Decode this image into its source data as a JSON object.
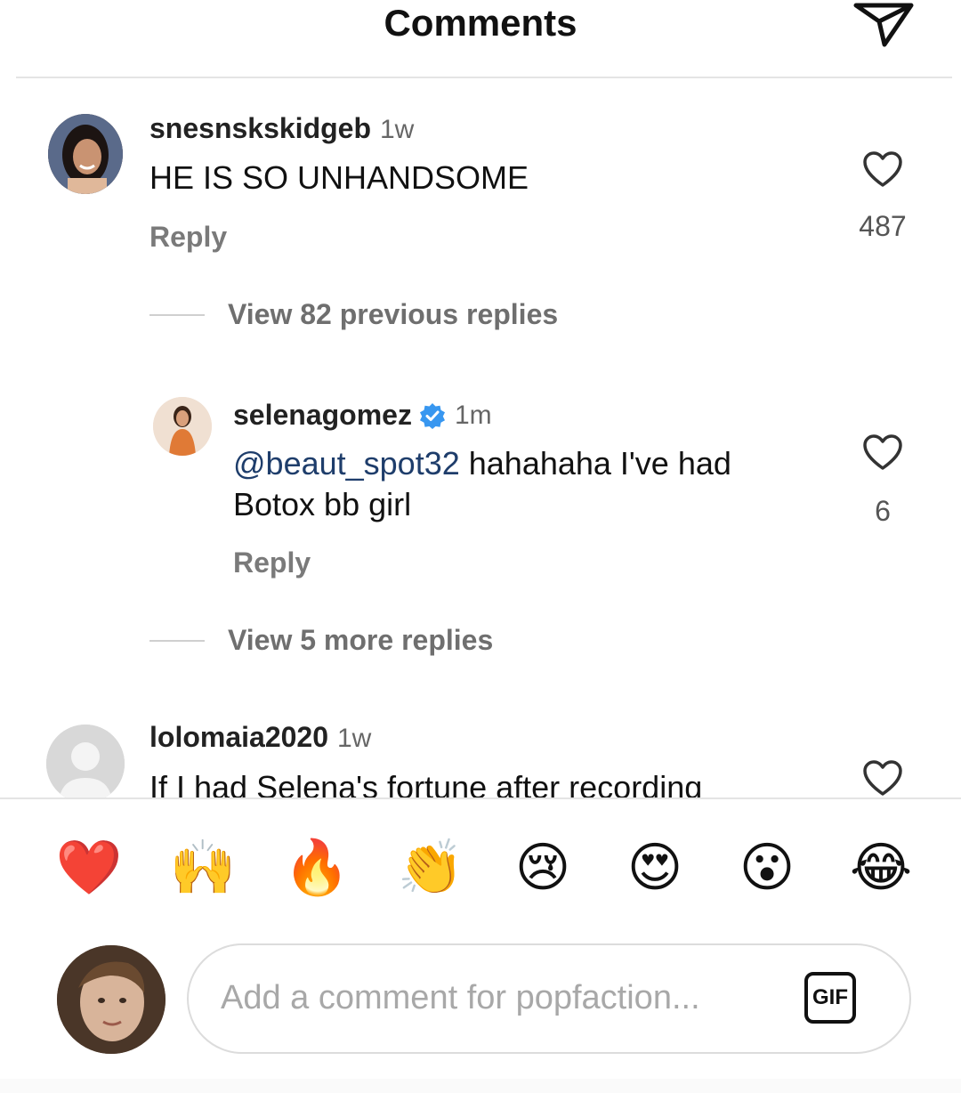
{
  "header": {
    "title": "Comments",
    "send_icon": "paper-plane-icon"
  },
  "comments": [
    {
      "username": "snesnskskidgeb",
      "time": "1w",
      "text": "HE IS SO UNHANDSOME",
      "reply_label": "Reply",
      "likes": "487",
      "view_replies": "View 82 previous replies"
    },
    {
      "username": "lolomaia2020",
      "time": "1w",
      "text": "If I had Selena's fortune after recording"
    }
  ],
  "reply": {
    "username": "selenagomez",
    "verified": true,
    "time": "1m",
    "mention": "@beaut_spot32",
    "text_line1": " hahahaha I've had",
    "text_line2": "Botox bb girl",
    "reply_label": "Reply",
    "likes": "6",
    "view_more": "View 5 more replies"
  },
  "emoji_bar": [
    "❤️",
    "🙌",
    "🔥",
    "👏",
    "😢",
    "😍",
    "😮",
    "😂"
  ],
  "composer": {
    "placeholder": "Add a comment for popfaction...",
    "gif_label": "GIF"
  },
  "colors": {
    "verified": "#3897f0",
    "mention": "#1e3d6b",
    "heart_emoji": "#e0245e"
  }
}
